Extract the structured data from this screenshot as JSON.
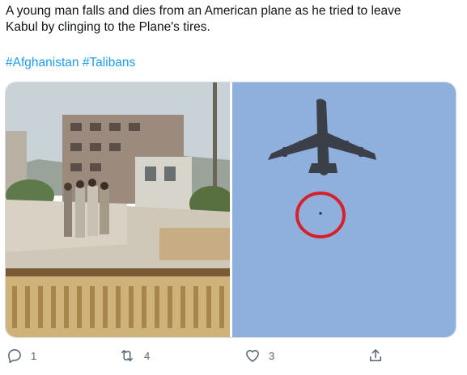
{
  "tweet": {
    "text": "A young man falls and dies from an American plane as he tried to leave\nKabul by clinging to the Plane's tires.",
    "hashtags": [
      "#Afghanistan",
      "#Talibans"
    ]
  },
  "actions": {
    "reply": {
      "icon": "reply-icon",
      "count": "1"
    },
    "retweet": {
      "icon": "retweet-icon",
      "count": "4"
    },
    "like": {
      "icon": "heart-icon",
      "count": "3"
    },
    "share": {
      "icon": "share-icon"
    }
  },
  "colors": {
    "text": "#0f1419",
    "link": "#1d9bf0",
    "muted": "#536471",
    "border": "#cfd9de",
    "sky": "#8fb0dc",
    "circle": "#d8202a"
  }
}
